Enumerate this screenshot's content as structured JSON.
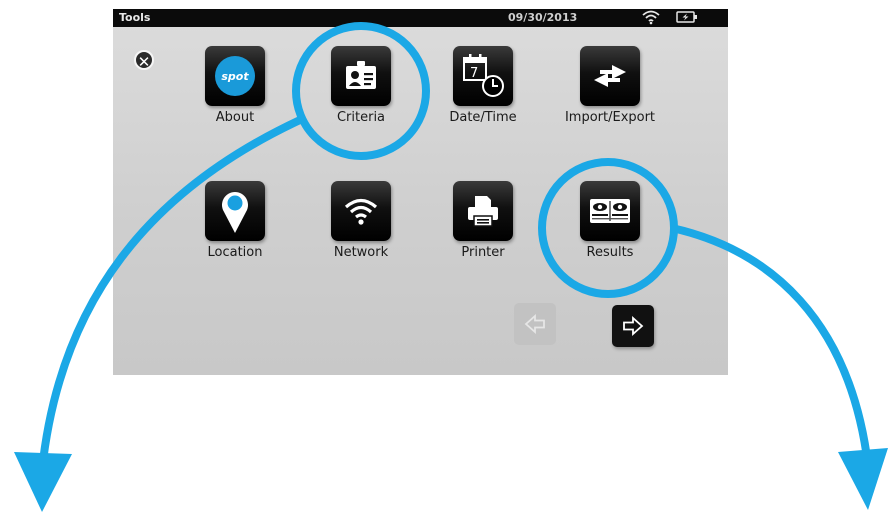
{
  "statusbar": {
    "title": "Tools",
    "date": "09/30/2013",
    "wifi_icon": "wifi-icon",
    "battery_icon": "battery-charging-icon"
  },
  "close_icon": "close-icon",
  "tools": [
    {
      "id": "about",
      "label": "About",
      "icon_text": "spot",
      "icon": "spot-logo-icon"
    },
    {
      "id": "criteria",
      "label": "Criteria",
      "icon": "id-card-icon"
    },
    {
      "id": "datetime",
      "label": "Date/Time",
      "icon": "calendar-clock-icon",
      "icon_day": "7"
    },
    {
      "id": "import-export",
      "label": "Import/Export",
      "icon": "swap-arrows-icon"
    },
    {
      "id": "location",
      "label": "Location",
      "icon": "location-pin-icon"
    },
    {
      "id": "network",
      "label": "Network",
      "icon": "wifi-icon"
    },
    {
      "id": "printer",
      "label": "Printer",
      "icon": "printer-icon"
    },
    {
      "id": "results",
      "label": "Results",
      "icon": "eye-results-icon"
    }
  ],
  "nav": {
    "prev_icon": "arrow-left-icon",
    "next_icon": "arrow-right-icon",
    "prev_enabled": false
  },
  "colors": {
    "highlight": "#1ba8e6",
    "location_pin": "#1aa0e0",
    "spot_badge": "#1a9ad9"
  }
}
